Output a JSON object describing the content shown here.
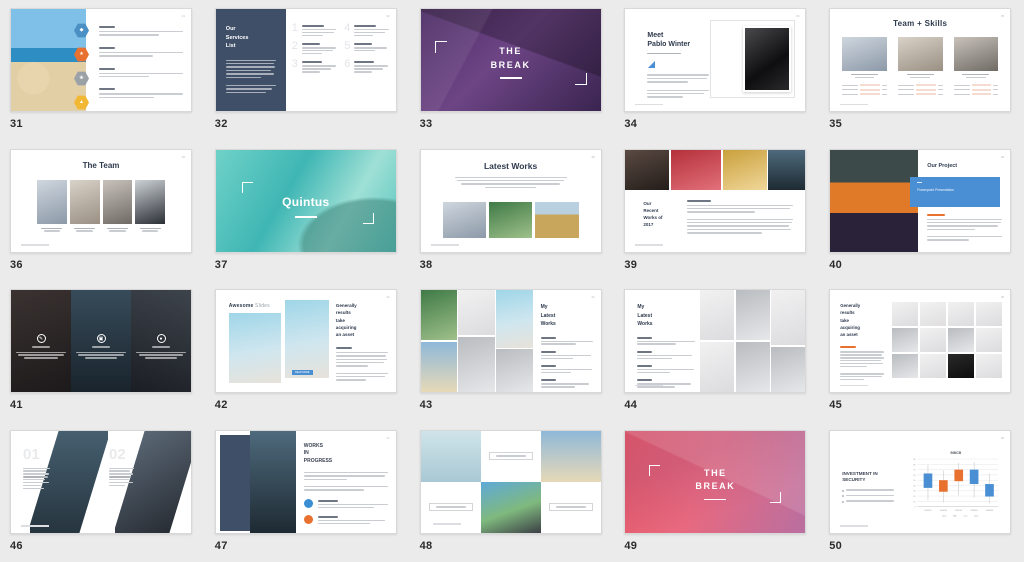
{
  "viewer": {
    "background_color": "#ebebeb",
    "layout": "slide-thumbnail-grid",
    "columns": 5,
    "rows": 4,
    "slide_range": "31-50"
  },
  "slides": [
    {
      "number": "31",
      "kind": "image-left-list-right",
      "page_marker": "31",
      "badges": [
        {
          "name": "shield-icon",
          "color": "#4a90c4",
          "glyph": "◆"
        },
        {
          "name": "star-icon",
          "color": "#e8712f",
          "glyph": "★"
        },
        {
          "name": "leaf-icon",
          "color": "#9aa2a8",
          "glyph": "❀"
        },
        {
          "name": "lock-icon",
          "color": "#f2b733",
          "glyph": "▲"
        }
      ],
      "items": [
        {
          "heading": "Feature one",
          "body": "Lorem ipsum dolor sit amet consectetur adipiscing elit sed do eiusmod tempor incididunt ut labore et dolore magna aliqua enim."
        },
        {
          "heading": "Feature two",
          "body": "Lorem ipsum dolor sit amet consectetur adipiscing elit sed do eiusmod tempor incididunt ut labore magna."
        },
        {
          "heading": "Feature three",
          "body": "Lorem ipsum dolor sit amet consectetur adipiscing elit sed do eiusmod tempor incididunt ut labore."
        },
        {
          "heading": "Feature four",
          "body": "Lorem ipsum dolor sit amet consectetur adipiscing elit sed do eiusmod tempor incididunt ut labore."
        }
      ]
    },
    {
      "number": "32",
      "kind": "dark-panel-numbered-list",
      "panel_color": "#3f4f68",
      "title": "Our\nServices\nList",
      "panel_body": "Lorem ipsum dolor sit amet consectetur adipiscing elit sed do eiusmod tempor incididunt ut labore et dolore magna aliqua.",
      "list": [
        {
          "index": "1",
          "heading": "List item one",
          "body": "Lorem ipsum dolor sit amet consectetur adipiscing elit sed tempor."
        },
        {
          "index": "2",
          "heading": "List two",
          "body": "Lorem ipsum dolor sit amet consectetur elit."
        },
        {
          "index": "3",
          "heading": "List three",
          "body": "Lorem ipsum dolor sit amet consectetur adipiscing."
        },
        {
          "index": "4",
          "heading": "List four",
          "body": "Lorem ipsum dolor sit amet consectetur adipiscing elit sed."
        },
        {
          "index": "5",
          "heading": "List five",
          "body": "Lorem ipsum dolor sit amet consectetur elit."
        },
        {
          "index": "6",
          "heading": "List six",
          "body": "Lorem ipsum dolor sit amet consectetur adipiscing."
        }
      ]
    },
    {
      "number": "33",
      "kind": "full-bleed-break",
      "title_line1": "THE",
      "title_line2": "BREAK",
      "overlay_color": "#5a3573"
    },
    {
      "number": "34",
      "kind": "profile-intro",
      "title_line1": "Meet",
      "title_line2": "Pablo Winter",
      "subtitle": "CREATIVE DIRECTOR",
      "paragraphs": [
        "Lorem ipsum dolor sit amet consectetur adipiscing elit sed do eiusmod tempor incididunt.",
        "Ut enim ad minim veniam quis nostrud exercitation ullamco laboris nisi ut aliquip ex ea."
      ],
      "footer": "www.yoursite.com"
    },
    {
      "number": "35",
      "kind": "team-skills",
      "title": "Team + Skills",
      "members": [
        {
          "name": "JOHN SMITH",
          "role": "DESIGNER",
          "skills": [
            {
              "label": "Photoshop",
              "value": "90%"
            },
            {
              "label": "Illustrator",
              "value": "75%"
            },
            {
              "label": "Marketing",
              "value": "60%"
            }
          ]
        },
        {
          "name": "ERIC MARTIN",
          "role": "DEVELOPER",
          "skills": [
            {
              "label": "Photoshop",
              "value": "80%"
            },
            {
              "label": "Illustrator",
              "value": "65%"
            },
            {
              "label": "Marketing",
              "value": "85%"
            }
          ]
        },
        {
          "name": "PAUL JONES",
          "role": "MARKETING",
          "skills": [
            {
              "label": "Photoshop",
              "value": "70%"
            },
            {
              "label": "Illustrator",
              "value": "88%"
            },
            {
              "label": "Marketing",
              "value": "55%"
            }
          ]
        }
      ],
      "footer": "www.yoursite.com"
    },
    {
      "number": "36",
      "kind": "team-four",
      "title": "The Team",
      "members": [
        {
          "name": "JOHN SMITH",
          "role": "ART DIRECTOR"
        },
        {
          "name": "ANNA STONE",
          "role": "PHOTOGRAPHER"
        },
        {
          "name": "KATE CLARK",
          "role": "STYLIST"
        },
        {
          "name": "BEN HARDY",
          "role": "MANAGER"
        }
      ],
      "footer": "www.yoursite.com"
    },
    {
      "number": "37",
      "kind": "full-bleed-title",
      "title": "Quintus"
    },
    {
      "number": "38",
      "kind": "latest-works-three",
      "title": "Latest Works",
      "subtitle": "Lorem ipsum dolor sit amet consectetur adipiscing elit sed do eiusmod tempor incididunt ut labore et dolore magna aliqua ut enim ad minim veniam quis nostrud.",
      "footer": "www.yoursite.com"
    },
    {
      "number": "39",
      "kind": "photo-strip-text",
      "title": "Our\nRecent\nWorks of\n2017",
      "body_heading": "Project notes",
      "paragraphs": [
        "Lorem ipsum dolor sit amet consectetur adipiscing elit sed do eiusmod tempor incididunt ut labore et dolore magna aliqua ut enim ad minim veniam.",
        "Quis nostrud exercitation ullamco laboris nisi ut aliquip ex ea commodo consequat duis aute irure dolor in reprehenderit in voluptate velit esse cillum dolore eu fugiat nulla pariatur excepteur sint occaecat cupidatat non proident."
      ],
      "footer": "www.yoursite.com"
    },
    {
      "number": "40",
      "kind": "project-callout",
      "title": "Our Project",
      "card_color": "#4a8fd4",
      "card_label": "Powerpoint Presentation",
      "section_heading": "Our Solutions",
      "paragraphs": [
        "Lorem ipsum dolor sit amet consectetur adipiscing elit sed do eiusmod tempor incididunt ut labore et dolore magna aliqua ut enim ad minim veniam quis nostrud exercitation.",
        "Duis aute irure dolor in reprehenderit in voluptate velit esse cillum dolore."
      ]
    },
    {
      "number": "41",
      "kind": "three-dark-panels",
      "panels": [
        {
          "icon": "pen-icon",
          "glyph": "✎",
          "heading": "IDEAS",
          "body": "Lorem ipsum dolor sit amet consectetur adipiscing elit sed do eiusmod tempor."
        },
        {
          "icon": "camera-icon",
          "glyph": "▣",
          "heading": "PHOTOS",
          "body": "Lorem ipsum dolor sit amet consectetur adipiscing elit sed do eiusmod tempor."
        },
        {
          "icon": "chat-icon",
          "glyph": "●",
          "heading": "TALKS",
          "body": "Lorem ipsum dolor sit amet consectetur adipiscing elit sed do eiusmod tempor."
        }
      ]
    },
    {
      "number": "42",
      "kind": "awesome-slides",
      "title_bold": "Awesome",
      "title_light": "Slides",
      "right_title": "Generally\nresults\ntake\nacquiring\nan asset",
      "right_heading": "Our Services",
      "right_paragraphs": [
        "Lorem ipsum dolor sit amet consectetur adipiscing elit sed do eiusmod tempor incididunt ut labore et dolore magna aliqua.",
        "Ut enim ad minim veniam quis nostrud exercitation ullamco laboris nisi ut aliquip ex ea commodo consequat."
      ],
      "button_label": "READ MORE",
      "button_color": "#4a8fd4"
    },
    {
      "number": "43",
      "kind": "mosaic-left-text-right",
      "title": "My\nLatest\nWorks",
      "items": [
        {
          "heading": "Project 1",
          "body": "Lorem ipsum dolor sit amet consectetur adipiscing elit sed tempor."
        },
        {
          "heading": "Project 2",
          "body": "Lorem ipsum dolor sit amet consectetur adipiscing elit sed."
        },
        {
          "heading": "Project 3",
          "body": "Lorem ipsum dolor sit amet consectetur adipiscing."
        },
        {
          "heading": "Project 4",
          "body": "Lorem ipsum dolor sit amet consectetur adipiscing elit."
        }
      ]
    },
    {
      "number": "44",
      "kind": "text-left-mosaic-right",
      "title": "My\nLatest\nWorks",
      "items": [
        {
          "heading": "Project 1",
          "body": "Lorem ipsum dolor sit amet consectetur adipiscing elit sed tempor."
        },
        {
          "heading": "Project 2",
          "body": "Lorem ipsum dolor sit amet consectetur adipiscing elit."
        },
        {
          "heading": "Project 3",
          "body": "Lorem ipsum dolor sit amet consectetur adipiscing elit sed."
        },
        {
          "heading": "Project 4",
          "body": "Lorem ipsum dolor sit amet consectetur adipiscing."
        }
      ],
      "footer": "www.yoursite.com"
    },
    {
      "number": "45",
      "kind": "text-left-grid-12",
      "title": "Generally\nresults\ntake\nacquiring\nan asset",
      "heading": "Our Products",
      "paragraphs": [
        "Lorem ipsum dolor sit amet consectetur adipiscing elit sed do eiusmod tempor incididunt ut labore et dolore magna aliqua ut enim ad minim veniam quis nostrud exercitation ullamco laboris nisi.",
        "Duis aute irure dolor in reprehenderit in voluptate velit esse cillum dolore eu fugiat."
      ],
      "footer": "www.yoursite.com"
    },
    {
      "number": "46",
      "kind": "diagonal-two-columns",
      "columns": [
        {
          "number": "01",
          "heading": "Mountain Trip",
          "body": "Lorem ipsum dolor sit amet consectetur adipiscing elit sed do eiusmod tempor incididunt ut labore et dolore magna aliqua ut enim ad minim veniam."
        },
        {
          "number": "02",
          "heading": "City Escape",
          "body": "Lorem ipsum dolor sit amet consectetur adipiscing elit sed do eiusmod tempor incididunt ut labore et dolore magna aliqua."
        }
      ],
      "footer": "www.yoursite.com"
    },
    {
      "number": "47",
      "kind": "works-in-progress",
      "sidebar_color": "#3f4f68",
      "title": "WORKS\nIN\nPROGRESS",
      "paragraphs": [
        "Lorem ipsum dolor sit amet consectetur adipiscing elit sed do eiusmod tempor incididunt ut labore et dolore magna aliqua ut enim ad minim veniam quis nostrud exercitation.",
        "Duis aute irure dolor in reprehenderit in voluptate velit esse cillum dolore eu fugiat nulla pariatur excepteur sint."
      ],
      "bullets": [
        {
          "color": "#3a8fd4",
          "heading": "First step forward",
          "body": "Lorem ipsum dolor sit amet consectetur adipiscing elit sed do eiusmod tempor incididunt ut labore."
        },
        {
          "color": "#e8712f",
          "heading": "Second step ahead",
          "body": "Lorem ipsum dolor sit amet consectetur adipiscing elit sed do eiusmod tempor."
        }
      ]
    },
    {
      "number": "48",
      "kind": "checkerboard-gallery",
      "cells": [
        {
          "type": "image",
          "photo": "ph-water"
        },
        {
          "type": "label",
          "label": "MINIMAL DESIGNS"
        },
        {
          "type": "image",
          "photo": "ph-sky"
        },
        {
          "type": "label",
          "label": "MINIMAL DESIGNS"
        },
        {
          "type": "image",
          "photo": "ph-camera"
        },
        {
          "type": "label",
          "label": "MINIMAL DESIGNS"
        }
      ],
      "footer": "www.yoursite.com"
    },
    {
      "number": "49",
      "kind": "full-bleed-break",
      "title_line1": "THE",
      "title_line2": "BREAK",
      "overlay_color": "#e8566b"
    },
    {
      "number": "50",
      "kind": "chart-slide",
      "title": "INVESTMENT IN\nSECURITY",
      "bullets": [
        "Nam sollicitudin eleifend hendrerit",
        "Suspendisse dictum congue lorem ut cursus",
        "Curabitur sodales congue purus sit amet"
      ],
      "footer": "www.yoursite.com"
    }
  ],
  "chart_data": {
    "type": "bar",
    "chart_variant": "open-high-low-close",
    "title": "BIMCB",
    "categories": [
      "2016/3/1",
      "2016/3/4",
      "2016/3/7",
      "2016/3/8",
      "2016/3/9"
    ],
    "legend": [
      "Open",
      "High",
      "Low",
      "Close"
    ],
    "series": [
      {
        "name": "Open",
        "values": [
          40,
          30,
          48,
          45,
          28
        ]
      },
      {
        "name": "High",
        "values": [
          78,
          66,
          82,
          84,
          58
        ]
      },
      {
        "name": "Low",
        "values": [
          12,
          10,
          22,
          18,
          8
        ]
      },
      {
        "name": "Close",
        "values": [
          62,
          50,
          70,
          68,
          42
        ]
      }
    ],
    "box_colors": [
      "#4a8fd4",
      "#e8712f",
      "#e8712f",
      "#4a8fd4",
      "#4a8fd4"
    ],
    "ylim": [
      0,
      90
    ],
    "yticks": [
      0,
      10,
      20,
      30,
      40,
      50,
      60,
      70,
      80,
      90
    ],
    "xlabel": "",
    "ylabel": "",
    "grid": true,
    "legend_position": "bottom"
  }
}
